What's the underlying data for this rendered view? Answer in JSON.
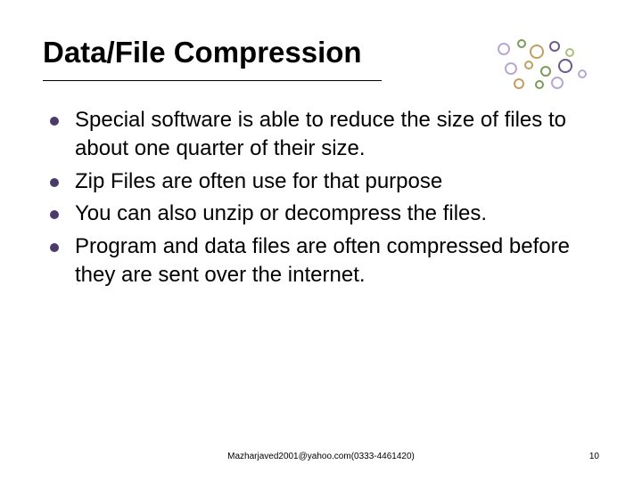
{
  "title": "Data/File Compression",
  "bullets": [
    "Special software is able to reduce the size of files to about one quarter of their size.",
    "Zip Files are often use for that purpose",
    "You can also unzip or decompress the files.",
    "Program and data files are often compressed before they are sent over the internet."
  ],
  "footer": "Mazharjaved2001@yahoo.com(0333-4461420)",
  "page_number": "10"
}
